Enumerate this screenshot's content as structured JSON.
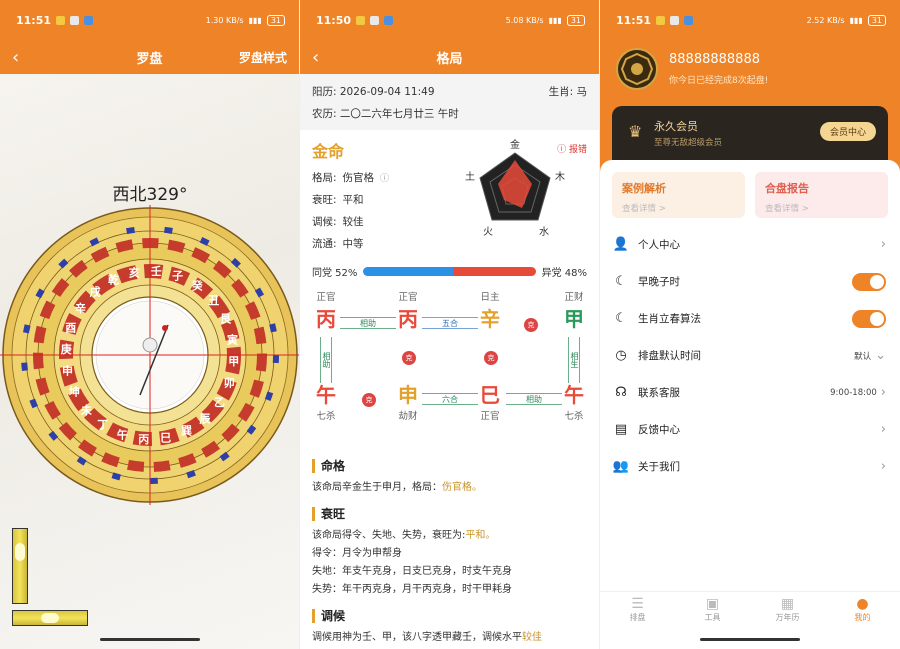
{
  "colors": {
    "accent": "#EE8327",
    "gold": "#E3A02A",
    "blue": "#2E8FE6",
    "red": "#E84A3A"
  },
  "compass_screen": {
    "status": {
      "time": "11:51",
      "net": "1.30 KB/s",
      "battery": "31"
    },
    "back_icon": "chevron-left-icon",
    "title": "罗盘",
    "style_btn": "罗盘样式",
    "heading": "西北329°",
    "ring_chars": [
      "乾",
      "亥",
      "壬",
      "子",
      "癸",
      "丑",
      "艮",
      "寅",
      "甲",
      "卯",
      "乙",
      "辰",
      "巽",
      "巳",
      "丙",
      "午",
      "丁",
      "未",
      "坤",
      "申",
      "庚",
      "酉",
      "辛",
      "戌"
    ]
  },
  "chart_screen": {
    "status": {
      "time": "11:50",
      "net": "5.08 KB/s",
      "battery": "31"
    },
    "title": "格局",
    "solar_label": "阳历: 2026-09-04 11:49",
    "zodiac": "生肖: 马",
    "lunar_label": "农历: 二〇二六年七月廿三 午时",
    "element": "金命",
    "report": "报错",
    "rows": [
      {
        "k": "格局:",
        "v": "伤官格"
      },
      {
        "k": "衰旺:",
        "v": "平和"
      },
      {
        "k": "调候:",
        "v": "较佳"
      },
      {
        "k": "流通:",
        "v": "中等"
      }
    ],
    "radar": {
      "top": "金",
      "left": "土",
      "right": "木",
      "bl": "火",
      "br": "水"
    },
    "same_party": "同党 52%",
    "diff_party": "异党 48%",
    "same_pct": 52,
    "pillars": {
      "top_labels": [
        "正官",
        "正官",
        "日主",
        "正财"
      ],
      "stems": [
        "丙",
        "丙",
        "辛",
        "甲"
      ],
      "branches": [
        "午",
        "申",
        "巳",
        "午"
      ],
      "bottom_labels": [
        "七杀",
        "劫财",
        "正官",
        "七杀"
      ]
    },
    "relations": {
      "xiangzhu": "相助",
      "wuhe": "五合",
      "liuhe": "六合",
      "xiangsheng": "相生",
      "ke": "克"
    },
    "sections": {
      "mingge_h": "命格",
      "mingge_p": "该命局辛金生于申月，格局：",
      "mingge_hl": "伤官格。",
      "shuaiwang_h": "衰旺",
      "sw1": "该命局得令、失地、失势，衰旺为:",
      "sw1_hl": "平和。",
      "sw2": "得令：月令为申帮身",
      "sw3": "失地：年支午克身，日支巳克身，时支午克身",
      "sw4": "失势：年干丙克身，月干丙克身，时干甲耗身",
      "tiaohou_h": "调候",
      "th1": "调候用神为壬、甲，该八字透甲藏壬，调候水平",
      "th1_hl": "较佳"
    }
  },
  "profile_screen": {
    "status": {
      "time": "11:51",
      "net": "2.52 KB/s",
      "battery": "31"
    },
    "phone": "88888888888",
    "subtitle": "你今日已经完成8次起盘!",
    "vip_title": "永久会员",
    "vip_sub": "至尊无敌超级会员",
    "vip_btn": "会员中心",
    "card1_title": "案例解析",
    "card1_sub": "查看详情 >",
    "card2_title": "合盘报告",
    "card2_sub": "查看详情 >",
    "menu": [
      {
        "label": "个人中心",
        "icon": "person-icon"
      },
      {
        "label": "早晚子时",
        "icon": "moon-icon",
        "toggle": true
      },
      {
        "label": "生肖立春算法",
        "icon": "moon-icon",
        "toggle": true
      },
      {
        "label": "排盘默认时间",
        "icon": "clock-icon",
        "right": "默认"
      },
      {
        "label": "联系客服",
        "icon": "headset-icon",
        "right": "9:00-18:00"
      },
      {
        "label": "反馈中心",
        "icon": "doc-icon"
      },
      {
        "label": "关于我们",
        "icon": "people-icon"
      }
    ],
    "tabs": [
      "排盘",
      "工具",
      "万年历",
      "我的"
    ]
  }
}
